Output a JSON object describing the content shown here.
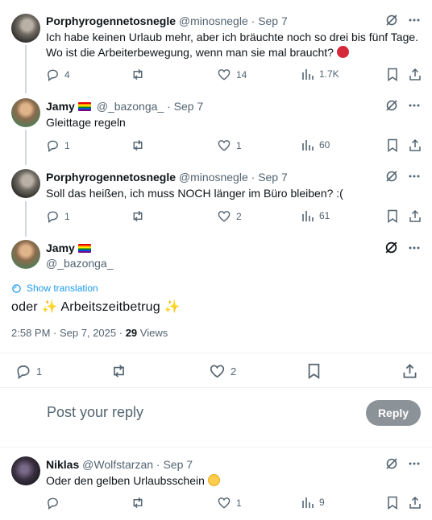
{
  "posts": [
    {
      "name": "Porphyrogennetosnegle",
      "handle": "@minosnegle",
      "sep": "·",
      "date": "Sep 7",
      "text1": "Ich habe keinen Urlaub mehr, aber ich bräuchte noch so drei bis fünf Tage.",
      "text2": "Wo ist die Arbeiterbewegung, wenn man sie mal braucht?",
      "replies": "4",
      "retweets": "",
      "likes": "14",
      "views": "1.7K"
    },
    {
      "name": "Jamy",
      "handle": "@_bazonga_",
      "sep": "·",
      "date": "Sep 7",
      "text1": "Gleittage regeln",
      "replies": "1",
      "retweets": "",
      "likes": "1",
      "views": "60"
    },
    {
      "name": "Porphyrogennetosnegle",
      "handle": "@minosnegle",
      "sep": "·",
      "date": "Sep 7",
      "text1": "Soll das heißen, ich muss NOCH länger im Büro bleiben? :(",
      "replies": "1",
      "retweets": "",
      "likes": "2",
      "views": "61"
    }
  ],
  "main": {
    "name": "Jamy",
    "handle": "@_bazonga_",
    "show_translation": "Show translation",
    "text_pre": "oder",
    "text_mid": "Arbeitszeitbetrug",
    "time": "2:58 PM",
    "date": "Sep 7, 2025",
    "views_count": "29",
    "views_label": "Views",
    "replies": "1",
    "likes": "2"
  },
  "composer": {
    "placeholder": "Post your reply",
    "button": "Reply"
  },
  "reply": {
    "name": "Niklas",
    "handle": "@Wolfstarzan",
    "sep": "·",
    "date": "Sep 7",
    "text": "Oder den gelben Urlaubsschein",
    "replies": "",
    "likes": "1",
    "views": "9"
  },
  "colors": {
    "accent": "#1d9bf0",
    "muted": "#536471",
    "reply_button": "#8b9399"
  }
}
